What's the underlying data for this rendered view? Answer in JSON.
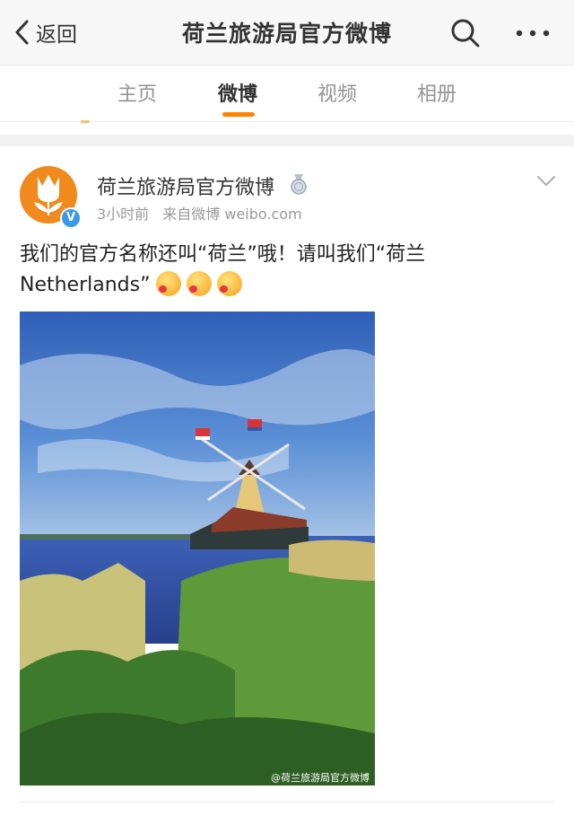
{
  "nav": {
    "back_label": "返回",
    "title": "荷兰旅游局官方微博"
  },
  "tabs": [
    {
      "label": "主页",
      "active": false
    },
    {
      "label": "微博",
      "active": true
    },
    {
      "label": "视频",
      "active": false
    },
    {
      "label": "相册",
      "active": false
    }
  ],
  "post": {
    "author": "荷兰旅游局官方微博",
    "time": "3小时前",
    "source": "来自微博 weibo.com",
    "text_line1": "我们的官方名称还叫“荷兰”哦！请叫我们“荷兰",
    "text_line2": "Netherlands”",
    "emoji_names": [
      "kiss-emoji",
      "kiss-emoji",
      "kiss-emoji"
    ],
    "photo_watermark": "@荷兰旅游局官方微博",
    "verified_mark": "V"
  },
  "colors": {
    "accent": "#ff8200",
    "avatar_bg": "#f08a1d",
    "verified": "#3b9bea"
  }
}
